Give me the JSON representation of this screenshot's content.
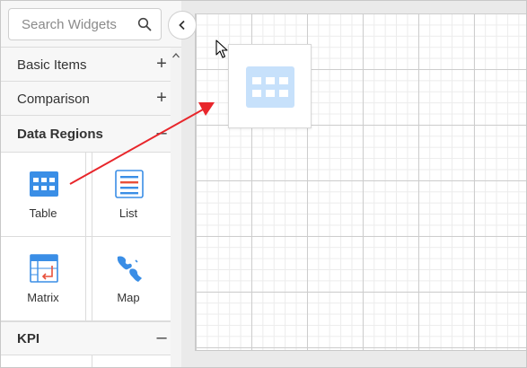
{
  "search": {
    "placeholder": "Search Widgets",
    "icon": "search-icon"
  },
  "sidebar": {
    "collapse_icon": "chevron-left-icon",
    "categories": [
      {
        "label": "Basic Items",
        "toggle": "+",
        "expanded": false
      },
      {
        "label": "Comparison",
        "toggle": "+",
        "expanded": false
      },
      {
        "label": "Data Regions",
        "toggle": "–",
        "expanded": true
      },
      {
        "label": "KPI",
        "toggle": "–",
        "expanded": true
      }
    ],
    "data_regions_items": [
      {
        "label": "Table",
        "icon": "table-icon"
      },
      {
        "label": "List",
        "icon": "list-icon"
      },
      {
        "label": "Matrix",
        "icon": "matrix-icon"
      },
      {
        "label": "Map",
        "icon": "map-icon"
      }
    ]
  },
  "drag": {
    "widget": "Table",
    "icon": "table-icon",
    "arrow_color": "#e8262b"
  },
  "colors": {
    "accent_blue": "#3a8ee6",
    "light_blue": "#c7e1fb",
    "canvas_bg": "#eaeaea"
  }
}
